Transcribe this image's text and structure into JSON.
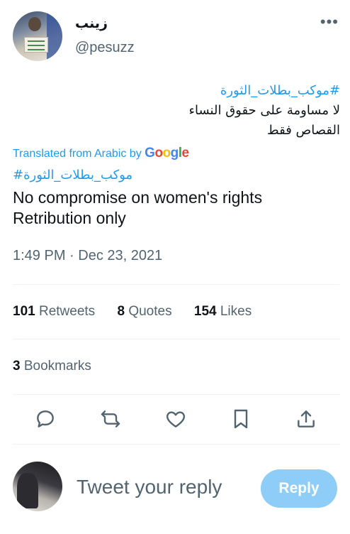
{
  "tweet": {
    "author": {
      "display_name": "زينب",
      "handle": "@pesuzz"
    },
    "more_icon": "ellipsis-icon",
    "original": {
      "hashtag": "#موكب_بطلات_الثورة",
      "line1": "لا مساومة على حقوق النساء",
      "line2": "القصاص فقط"
    },
    "translation": {
      "label": "Translated from Arabic by",
      "provider": [
        "G",
        "o",
        "o",
        "g",
        "l",
        "e"
      ],
      "hashtag": "#موكب_بطلات_الثورة",
      "line1": "No compromise on women's rights",
      "line2": "Retribution only"
    },
    "timestamp": "1:49 PM · Dec 23, 2021",
    "stats": {
      "retweets_count": "101",
      "retweets_label": "Retweets",
      "quotes_count": "8",
      "quotes_label": "Quotes",
      "likes_count": "154",
      "likes_label": "Likes",
      "bookmarks_count": "3",
      "bookmarks_label": "Bookmarks"
    },
    "actions": [
      "reply-icon",
      "retweet-icon",
      "like-icon",
      "bookmark-icon",
      "share-icon"
    ]
  },
  "reply_box": {
    "placeholder": "Tweet your reply",
    "button_label": "Reply"
  },
  "colors": {
    "accent": "#1d9bf0",
    "muted": "#536471",
    "text": "#0f1419",
    "reply_button": "#8ecdf8"
  }
}
